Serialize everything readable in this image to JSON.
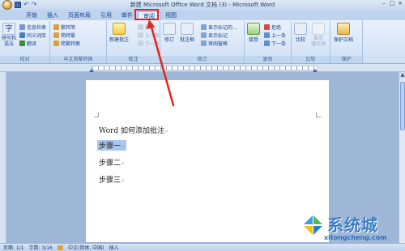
{
  "window": {
    "title": "新建 Microsoft Office Word 文档 (3) - Microsoft Word",
    "buttons": [
      "–",
      "□",
      "×"
    ]
  },
  "tabs": [
    "开始",
    "插入",
    "页面布局",
    "引用",
    "邮件",
    "审阅",
    "视图"
  ],
  "active_tab": "审阅",
  "ribbon": {
    "proofing": {
      "label": "校对",
      "spelling": "拼写和语法",
      "research": "信息检索",
      "thesaurus": "同义词库",
      "translate": "翻译"
    },
    "chinese": {
      "label": "中文简繁转换",
      "to_simplified": "繁转简",
      "to_traditional": "简转繁",
      "convert": "简繁转换"
    },
    "comments": {
      "label": "批注",
      "new": "新建批注",
      "delete": "删除",
      "prev": "上一条",
      "next": "下一条"
    },
    "tracking": {
      "label": "修订",
      "track": "修订",
      "balloons": "批注框",
      "show_markup": "显示标记的...",
      "show": "显示标记",
      "pane": "审阅窗格"
    },
    "changes": {
      "label": "更改",
      "accept": "接受",
      "reject": "拒绝",
      "prev": "上一条",
      "next": "下一条"
    },
    "compare": {
      "label": "比较",
      "compare": "比较",
      "source": "显示\n源文档"
    },
    "protect": {
      "label": "保护",
      "protect": "保护文档"
    }
  },
  "document": {
    "lines": [
      "Word 如何添加批注",
      "步骤一",
      "步骤二",
      "步骤三"
    ],
    "para_mark": "↵"
  },
  "status": {
    "page": "页面: 1/1",
    "words": "字数: 3/16",
    "language": "中文(简体, 中国)",
    "mode": "插入"
  },
  "watermark": {
    "brand": "系统城",
    "url": "xitongcheng.com"
  },
  "colors": {
    "highlight": "#e5241d",
    "selection": "#a8c7ef",
    "ribbon_text": "#15428b"
  }
}
